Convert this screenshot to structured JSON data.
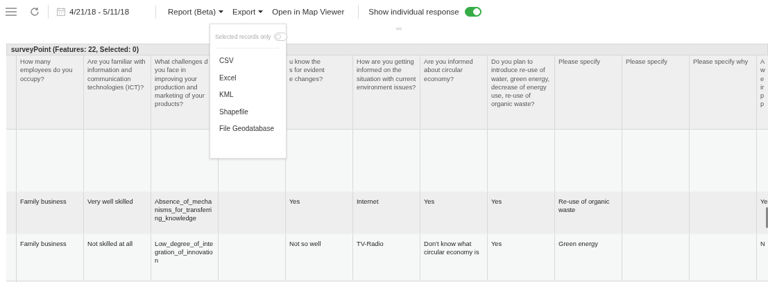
{
  "toolbar": {
    "date_range": "4/21/18 - 5/11/18",
    "menus": [
      {
        "label": "Report (Beta)",
        "kind": "dropdown"
      },
      {
        "label": "Export",
        "kind": "dropdown"
      },
      {
        "label": "Open in Map Viewer",
        "kind": "link"
      }
    ],
    "toggle": {
      "label": "Show individual response",
      "on": true
    }
  },
  "export_menu": {
    "selected_only": {
      "label": "Selected records only",
      "on": false
    },
    "items": [
      "CSV",
      "Excel",
      "KML",
      "Shapefile",
      "File Geodatabase"
    ]
  },
  "table": {
    "title": "surveyPoint (Features: 22, Selected: 0)",
    "columns": [
      "How many employees do you occupy?",
      "Are you familiar with information and communication technologies (ICT)?",
      "What challenges d\nyou face in\nimproving your\nproduction and\nmarketing of your\nproducts?",
      null,
      "u know the\ns for evident\ne changes?",
      "How are you getting informed on the situation with current environment issues?",
      "Are you informed about circular economy?",
      "Do you plan to introduce re-use of water, green energy, decrease of energy use, re-use of organic waste?",
      "Please specify",
      "Please specify",
      "Please specify why",
      "A\nw\ne\nir\np\np"
    ],
    "rows": [
      {
        "cells": [
          "Family business",
          "Very well skilled",
          "Absence_of_mechanisms_for_transferring_knowledge",
          null,
          "Yes",
          "Internet",
          "Yes",
          "Yes",
          "Re-use of organic waste",
          null,
          null,
          "Ye"
        ]
      },
      {
        "cells": [
          "Family business",
          "Not skilled at all",
          "Low_degree_of_integration_of_innovation",
          null,
          "Not so well",
          "TV-Radio",
          "Don’t know what circular economy is",
          "Yes",
          "Green energy",
          null,
          null,
          "N"
        ]
      }
    ]
  }
}
